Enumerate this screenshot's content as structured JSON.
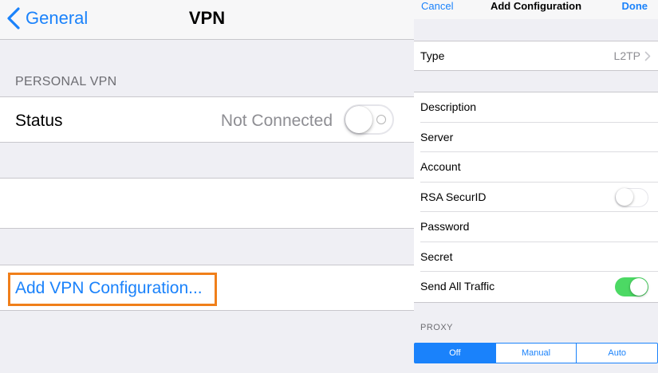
{
  "left": {
    "nav": {
      "back_label": "General",
      "title": "VPN"
    },
    "section_header": "PERSONAL VPN",
    "status": {
      "label": "Status",
      "value": "Not Connected",
      "toggle_on": false
    },
    "add_vpn_label": "Add VPN Configuration..."
  },
  "right": {
    "nav": {
      "cancel": "Cancel",
      "title": "Add Configuration",
      "done": "Done"
    },
    "type": {
      "label": "Type",
      "value": "L2TP"
    },
    "fields": {
      "description": "Description",
      "server": "Server",
      "account": "Account",
      "rsa": "RSA SecurID",
      "password": "Password",
      "secret": "Secret",
      "send_all": "Send All Traffic"
    },
    "toggles": {
      "rsa_on": false,
      "send_all_on": true
    },
    "proxy_header": "PROXY",
    "proxy_options": [
      "Off",
      "Manual",
      "Auto"
    ],
    "proxy_selected": "Off"
  },
  "colors": {
    "accent": "#1a82fb",
    "highlight_box": "#f07f1a",
    "switch_on": "#4cd964",
    "background": "#efeff4"
  }
}
